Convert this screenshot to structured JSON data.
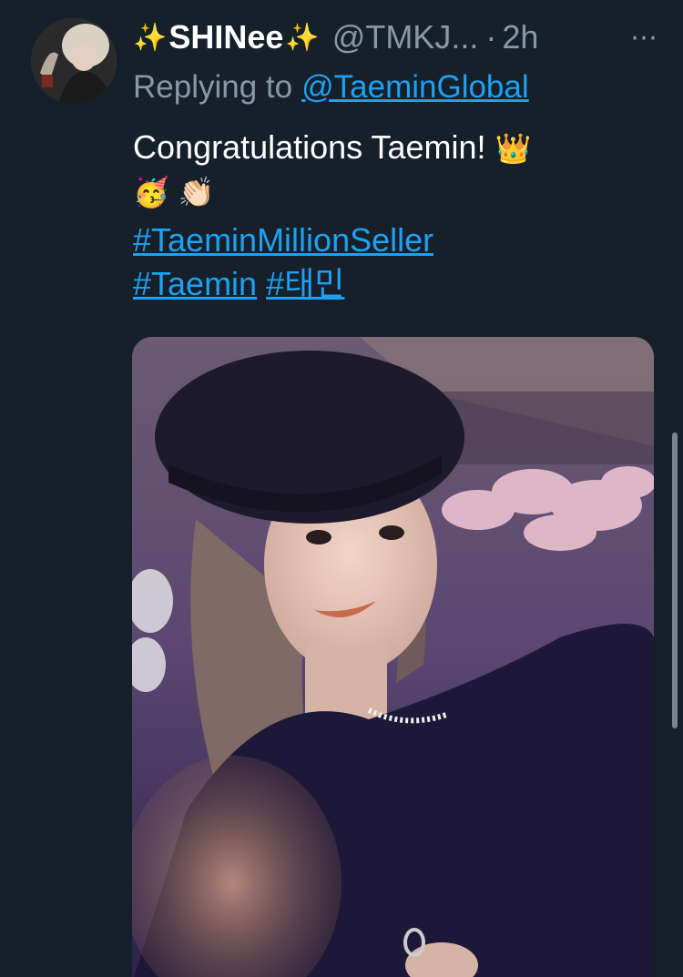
{
  "tweet": {
    "display_name": "SHINee",
    "name_sparkle_left": "✨",
    "name_sparkle_right": "✨",
    "handle": "@TMKJ...",
    "separator": "·",
    "time": "2h",
    "more_icon": "⋯",
    "reply_prefix": "Replying to",
    "reply_to": "@TaeminGlobal",
    "text_line1": "Congratulations Taemin!",
    "emoji_crown": "👑",
    "emoji_party": "🥳",
    "emoji_clap": "👏🏻",
    "hashtag1": "#TaeminMillionSeller",
    "hashtag2": "#Taemin",
    "hashtag3": "#태민"
  },
  "colors": {
    "background": "#15202b",
    "link": "#1da1f2",
    "secondary_text": "#8899a6",
    "primary_text": "#ffffff"
  },
  "icons": {
    "avatar": "profile-photo",
    "more": "more-horizontal-icon",
    "media": "tweet-photo"
  }
}
